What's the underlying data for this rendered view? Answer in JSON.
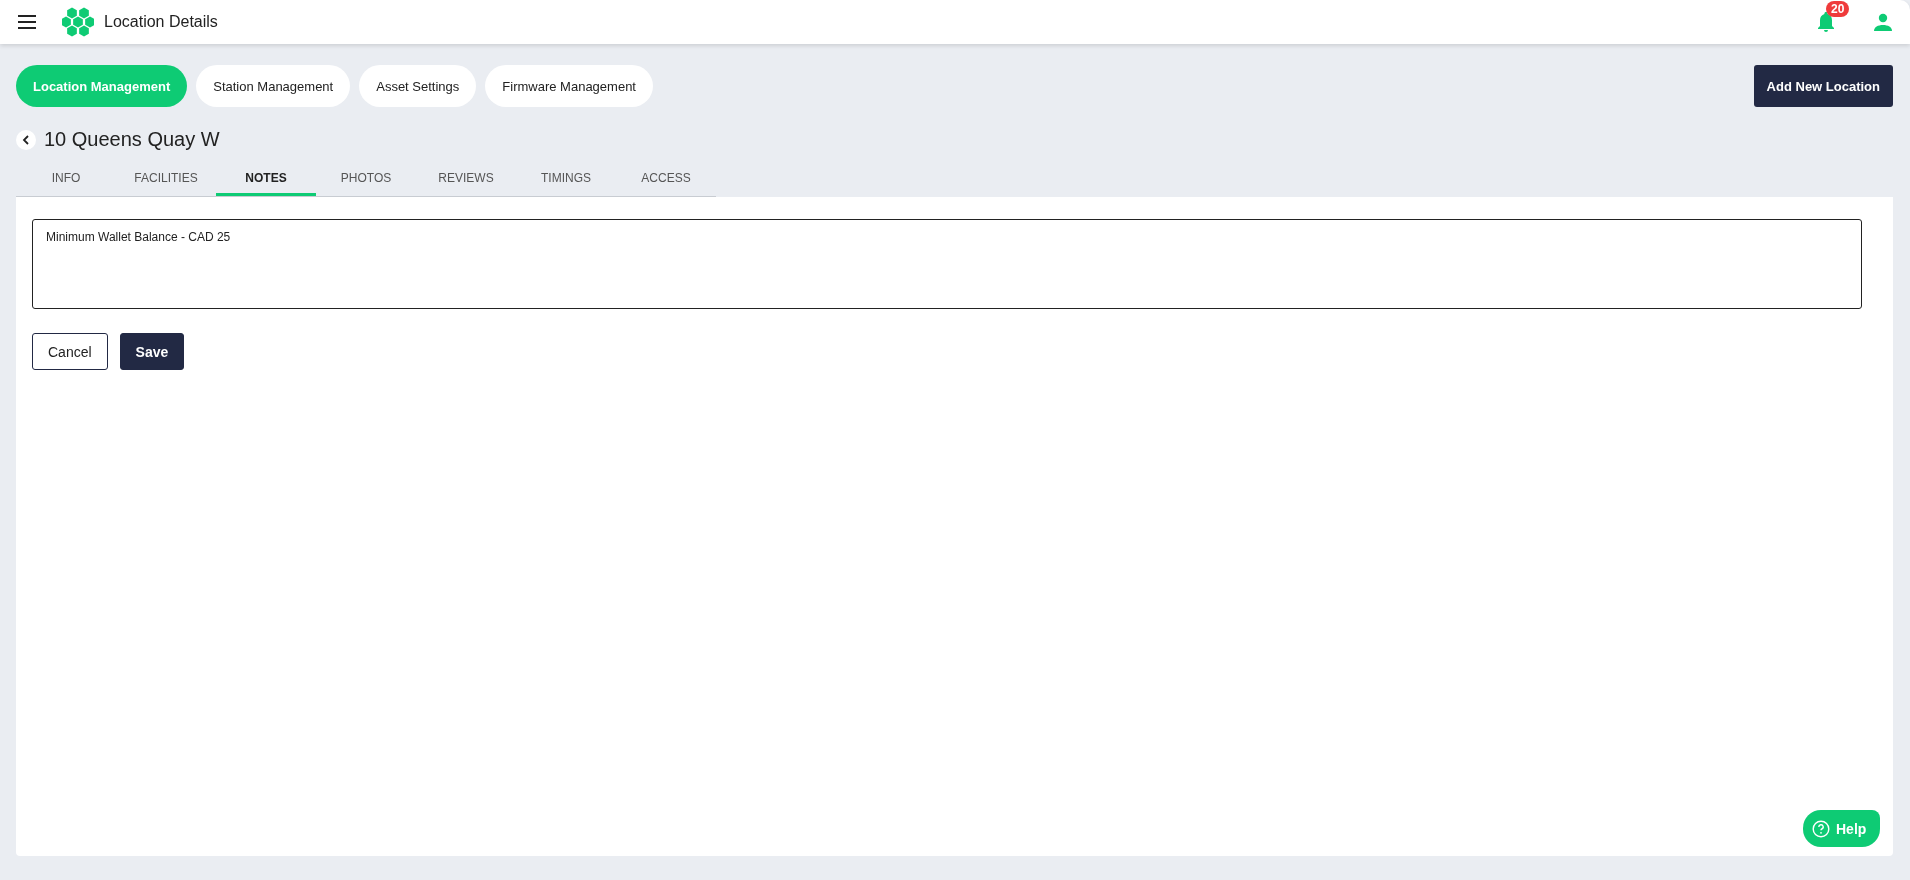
{
  "header": {
    "title": "Location Details",
    "notification_count": "20"
  },
  "nav_tabs": [
    {
      "label": "Location Management",
      "selected": true
    },
    {
      "label": "Station Management",
      "selected": false
    },
    {
      "label": "Asset Settings",
      "selected": false
    },
    {
      "label": "Firmware Management",
      "selected": false
    }
  ],
  "add_button": "Add New Location",
  "location_title": "10 Queens Quay W",
  "tabs": [
    {
      "label": "INFO",
      "selected": false
    },
    {
      "label": "FACILITIES",
      "selected": false
    },
    {
      "label": "NOTES",
      "selected": true
    },
    {
      "label": "PHOTOS",
      "selected": false
    },
    {
      "label": "REVIEWS",
      "selected": false
    },
    {
      "label": "TIMINGS",
      "selected": false
    },
    {
      "label": "ACCESS",
      "selected": false
    }
  ],
  "notes": {
    "value": "Minimum Wallet Balance - CAD 25"
  },
  "buttons": [
    {
      "label": "Cancel",
      "kind": "secondary"
    },
    {
      "label": "Save",
      "kind": "primary"
    }
  ],
  "help_button": "Help"
}
